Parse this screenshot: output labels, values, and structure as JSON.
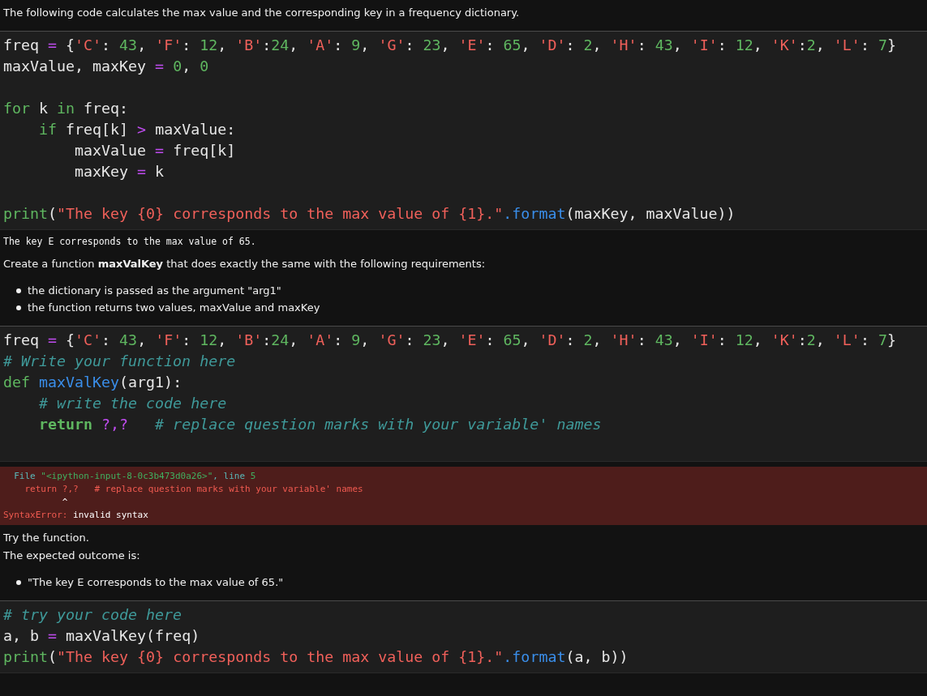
{
  "cells": [
    {
      "kind": "markdown",
      "blocks": [
        {
          "kind": "para",
          "text": "The following code calculates the max value and the corresponding key in a frequency dictionary."
        }
      ]
    },
    {
      "kind": "code",
      "trailing_blank": false,
      "groups": [
        [
          {
            "tokens": [
              {
                "kind": "plain",
                "text": "freq "
              },
              {
                "kind": "op",
                "text": "="
              },
              {
                "kind": "plain",
                "text": " {"
              },
              {
                "kind": "str",
                "text": "'C'"
              },
              {
                "kind": "plain",
                "text": ": "
              },
              {
                "kind": "num",
                "text": "43"
              },
              {
                "kind": "plain",
                "text": ", "
              },
              {
                "kind": "str",
                "text": "'F'"
              },
              {
                "kind": "plain",
                "text": ": "
              },
              {
                "kind": "num",
                "text": "12"
              },
              {
                "kind": "plain",
                "text": ", "
              },
              {
                "kind": "str",
                "text": "'B'"
              },
              {
                "kind": "plain",
                "text": ":"
              },
              {
                "kind": "num",
                "text": "24"
              },
              {
                "kind": "plain",
                "text": ", "
              },
              {
                "kind": "str",
                "text": "'A'"
              },
              {
                "kind": "plain",
                "text": ": "
              },
              {
                "kind": "num",
                "text": "9"
              },
              {
                "kind": "plain",
                "text": ", "
              },
              {
                "kind": "str",
                "text": "'G'"
              },
              {
                "kind": "plain",
                "text": ": "
              },
              {
                "kind": "num",
                "text": "23"
              },
              {
                "kind": "plain",
                "text": ", "
              },
              {
                "kind": "str",
                "text": "'E'"
              },
              {
                "kind": "plain",
                "text": ": "
              },
              {
                "kind": "num",
                "text": "65"
              },
              {
                "kind": "plain",
                "text": ", "
              },
              {
                "kind": "str",
                "text": "'D'"
              },
              {
                "kind": "plain",
                "text": ": "
              },
              {
                "kind": "num",
                "text": "2"
              },
              {
                "kind": "plain",
                "text": ", "
              },
              {
                "kind": "str",
                "text": "'H'"
              },
              {
                "kind": "plain",
                "text": ": "
              },
              {
                "kind": "num",
                "text": "43"
              },
              {
                "kind": "plain",
                "text": ", "
              },
              {
                "kind": "str",
                "text": "'I'"
              },
              {
                "kind": "plain",
                "text": ": "
              },
              {
                "kind": "num",
                "text": "12"
              },
              {
                "kind": "plain",
                "text": ", "
              },
              {
                "kind": "str",
                "text": "'K'"
              },
              {
                "kind": "plain",
                "text": ":"
              },
              {
                "kind": "num",
                "text": "2"
              },
              {
                "kind": "plain",
                "text": ", "
              },
              {
                "kind": "str",
                "text": "'L'"
              },
              {
                "kind": "plain",
                "text": ": "
              },
              {
                "kind": "num",
                "text": "7"
              },
              {
                "kind": "plain",
                "text": "}"
              }
            ]
          },
          {
            "tokens": [
              {
                "kind": "plain",
                "text": "maxValue, maxKey "
              },
              {
                "kind": "op",
                "text": "="
              },
              {
                "kind": "num",
                "text": " 0"
              },
              {
                "kind": "plain",
                "text": ", "
              },
              {
                "kind": "num",
                "text": "0"
              }
            ]
          }
        ],
        [
          {
            "tokens": [
              {
                "kind": "kw",
                "text": "for"
              },
              {
                "kind": "plain",
                "text": " k "
              },
              {
                "kind": "kw",
                "text": "in"
              },
              {
                "kind": "plain",
                "text": " freq:"
              }
            ]
          },
          {
            "tokens": [
              {
                "kind": "kw",
                "text": "    if"
              },
              {
                "kind": "plain",
                "text": " freq[k] "
              },
              {
                "kind": "op",
                "text": ">"
              },
              {
                "kind": "plain",
                "text": " maxValue:"
              }
            ]
          },
          {
            "tokens": [
              {
                "kind": "plain",
                "text": "        maxValue "
              },
              {
                "kind": "op",
                "text": "="
              },
              {
                "kind": "plain",
                "text": " freq[k]"
              }
            ]
          },
          {
            "tokens": [
              {
                "kind": "plain",
                "text": "        maxKey "
              },
              {
                "kind": "op",
                "text": "="
              },
              {
                "kind": "plain",
                "text": " k"
              }
            ]
          }
        ],
        [
          {
            "tokens": [
              {
                "kind": "kw",
                "text": "print"
              },
              {
                "kind": "plain",
                "text": "("
              },
              {
                "kind": "str",
                "text": "\"The key {0} corresponds to the max value of {1}.\""
              },
              {
                "kind": "fn",
                "text": ".format"
              },
              {
                "kind": "plain",
                "text": "(maxKey, maxValue))"
              }
            ]
          }
        ]
      ]
    },
    {
      "kind": "output",
      "lines": [
        "The key E corresponds to the max value of 65."
      ]
    },
    {
      "kind": "markdown",
      "blocks": [
        {
          "kind": "para",
          "text": "Create a function **maxValKey** that does exactly the same with the following requirements:"
        },
        {
          "kind": "list",
          "items": [
            "the dictionary is passed as the argument \"arg1\"",
            "the function returns two values, maxValue and maxKey"
          ]
        }
      ]
    },
    {
      "kind": "code",
      "trailing_blank": true,
      "groups": [
        [
          {
            "tokens": [
              {
                "kind": "plain",
                "text": "freq "
              },
              {
                "kind": "op",
                "text": "="
              },
              {
                "kind": "plain",
                "text": " {"
              },
              {
                "kind": "str",
                "text": "'C'"
              },
              {
                "kind": "plain",
                "text": ": "
              },
              {
                "kind": "num",
                "text": "43"
              },
              {
                "kind": "plain",
                "text": ", "
              },
              {
                "kind": "str",
                "text": "'F'"
              },
              {
                "kind": "plain",
                "text": ": "
              },
              {
                "kind": "num",
                "text": "12"
              },
              {
                "kind": "plain",
                "text": ", "
              },
              {
                "kind": "str",
                "text": "'B'"
              },
              {
                "kind": "plain",
                "text": ":"
              },
              {
                "kind": "num",
                "text": "24"
              },
              {
                "kind": "plain",
                "text": ", "
              },
              {
                "kind": "str",
                "text": "'A'"
              },
              {
                "kind": "plain",
                "text": ": "
              },
              {
                "kind": "num",
                "text": "9"
              },
              {
                "kind": "plain",
                "text": ", "
              },
              {
                "kind": "str",
                "text": "'G'"
              },
              {
                "kind": "plain",
                "text": ": "
              },
              {
                "kind": "num",
                "text": "23"
              },
              {
                "kind": "plain",
                "text": ", "
              },
              {
                "kind": "str",
                "text": "'E'"
              },
              {
                "kind": "plain",
                "text": ": "
              },
              {
                "kind": "num",
                "text": "65"
              },
              {
                "kind": "plain",
                "text": ", "
              },
              {
                "kind": "str",
                "text": "'D'"
              },
              {
                "kind": "plain",
                "text": ": "
              },
              {
                "kind": "num",
                "text": "2"
              },
              {
                "kind": "plain",
                "text": ", "
              },
              {
                "kind": "str",
                "text": "'H'"
              },
              {
                "kind": "plain",
                "text": ": "
              },
              {
                "kind": "num",
                "text": "43"
              },
              {
                "kind": "plain",
                "text": ", "
              },
              {
                "kind": "str",
                "text": "'I'"
              },
              {
                "kind": "plain",
                "text": ": "
              },
              {
                "kind": "num",
                "text": "12"
              },
              {
                "kind": "plain",
                "text": ", "
              },
              {
                "kind": "str",
                "text": "'K'"
              },
              {
                "kind": "plain",
                "text": ":"
              },
              {
                "kind": "num",
                "text": "2"
              },
              {
                "kind": "plain",
                "text": ", "
              },
              {
                "kind": "str",
                "text": "'L'"
              },
              {
                "kind": "plain",
                "text": ": "
              },
              {
                "kind": "num",
                "text": "7"
              },
              {
                "kind": "plain",
                "text": "}"
              }
            ]
          },
          {
            "tokens": [
              {
                "kind": "com",
                "text": "# Write your function here"
              }
            ]
          },
          {
            "tokens": [
              {
                "kind": "kw",
                "text": "def"
              },
              {
                "kind": "fn",
                "text": " maxValKey"
              },
              {
                "kind": "plain",
                "text": "(arg1):"
              }
            ]
          },
          {
            "tokens": [
              {
                "kind": "com",
                "text": "    # write the code here"
              }
            ]
          },
          {
            "tokens": [
              {
                "kind": "bold",
                "text": "    return"
              },
              {
                "kind": "op",
                "text": " ?,?"
              },
              {
                "kind": "com",
                "text": "   # replace question marks with your variable' names"
              }
            ]
          }
        ]
      ]
    },
    {
      "kind": "error",
      "lines": [
        [
          {
            "kind": "cyan",
            "text": "  File "
          },
          {
            "kind": "green",
            "text": "\"<ipython-input-8-0c3b473d0a26>\""
          },
          {
            "kind": "cyan",
            "text": ", line "
          },
          {
            "kind": "green",
            "text": "5"
          }
        ],
        [
          {
            "kind": "red",
            "text": "    return ?,?   # replace question marks with your variable' names"
          }
        ],
        [
          {
            "kind": "white",
            "text": "           ^"
          }
        ],
        [
          {
            "kind": "red",
            "text": "SyntaxError:"
          },
          {
            "kind": "white",
            "text": " invalid syntax"
          }
        ]
      ]
    },
    {
      "kind": "markdown",
      "blocks": [
        {
          "kind": "para",
          "text": "Try the function."
        },
        {
          "kind": "para",
          "text": "The expected outcome is:"
        },
        {
          "kind": "list",
          "items": [
            "\"The key E corresponds to the max value of 65.\""
          ]
        }
      ]
    },
    {
      "kind": "code",
      "trailing_blank": false,
      "groups": [
        [
          {
            "tokens": [
              {
                "kind": "com",
                "text": "# try your code here"
              }
            ]
          },
          {
            "tokens": [
              {
                "kind": "plain",
                "text": "a, b "
              },
              {
                "kind": "op",
                "text": "="
              },
              {
                "kind": "plain",
                "text": " maxValKey(freq)"
              }
            ]
          },
          {
            "tokens": [
              {
                "kind": "kw",
                "text": "print"
              },
              {
                "kind": "plain",
                "text": "("
              },
              {
                "kind": "str",
                "text": "\"The key {0} corresponds to the max value of {1}.\""
              },
              {
                "kind": "fn",
                "text": ".format"
              },
              {
                "kind": "plain",
                "text": "(a, b))"
              }
            ]
          }
        ]
      ]
    }
  ]
}
